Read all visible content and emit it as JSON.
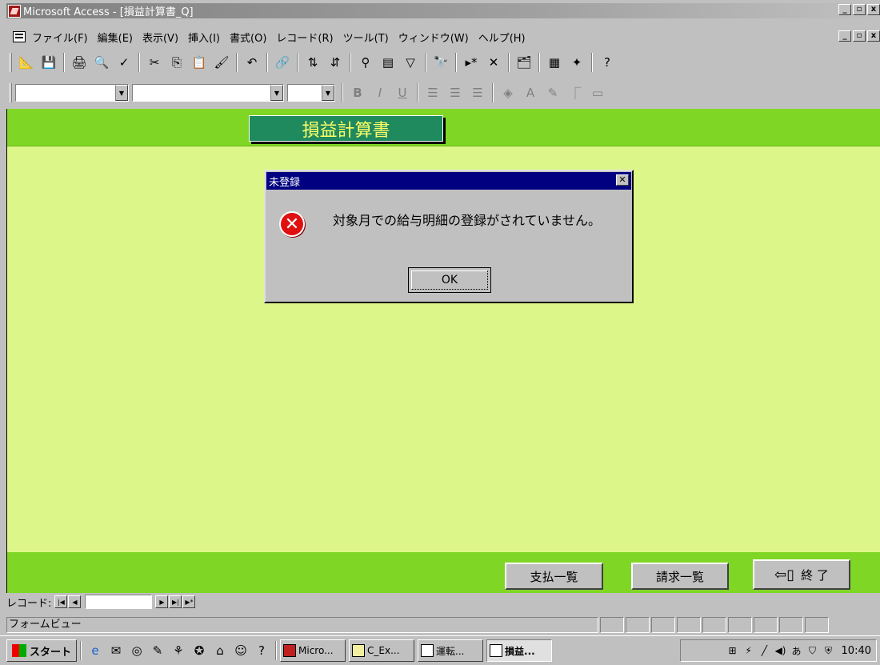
{
  "window": {
    "title": "Microsoft Access - [損益計算書_Q]",
    "minimize": "_",
    "restore": "▫",
    "close": "x"
  },
  "menu": [
    "ファイル(F)",
    "編集(E)",
    "表示(V)",
    "挿入(I)",
    "書式(O)",
    "レコード(R)",
    "ツール(T)",
    "ウィンドウ(W)",
    "ヘルプ(H)"
  ],
  "toolbar_icons": [
    "design-view-icon",
    "save-icon",
    "print-icon",
    "print-preview-icon",
    "spell-check-icon",
    "cut-icon",
    "copy-icon",
    "paste-icon",
    "format-painter-icon",
    "undo-icon",
    "hyperlink-icon",
    "sort-ascending-icon",
    "sort-descending-icon",
    "filter-by-selection-icon",
    "filter-by-form-icon",
    "apply-filter-icon",
    "find-icon",
    "new-record-icon",
    "delete-record-icon",
    "properties-icon",
    "database-window-icon",
    "new-object-icon",
    "help-icon"
  ],
  "form": {
    "title": "損益計算書",
    "buttons": {
      "shiharai": "支払一覧",
      "seikyu": "請求一覧",
      "exit": "終 了"
    },
    "colors": {
      "background": "#ddf68a",
      "header": "#80d625",
      "title_bg": "#1f8a5e",
      "title_text": "#ffff66"
    }
  },
  "dialog": {
    "title": "未登録",
    "message": "対象月での給与明細の登録がされていません。",
    "ok": "OK",
    "icon": "error-icon"
  },
  "record_nav": {
    "label": "レコード:",
    "value": ""
  },
  "status": {
    "text": "フォームビュー"
  },
  "taskbar": {
    "start": "スタート",
    "tasks": [
      {
        "label": "Micro..."
      },
      {
        "label": "C_Ex..."
      },
      {
        "label": "運転..."
      },
      {
        "label": "損益..."
      }
    ],
    "clock": "10:40"
  }
}
